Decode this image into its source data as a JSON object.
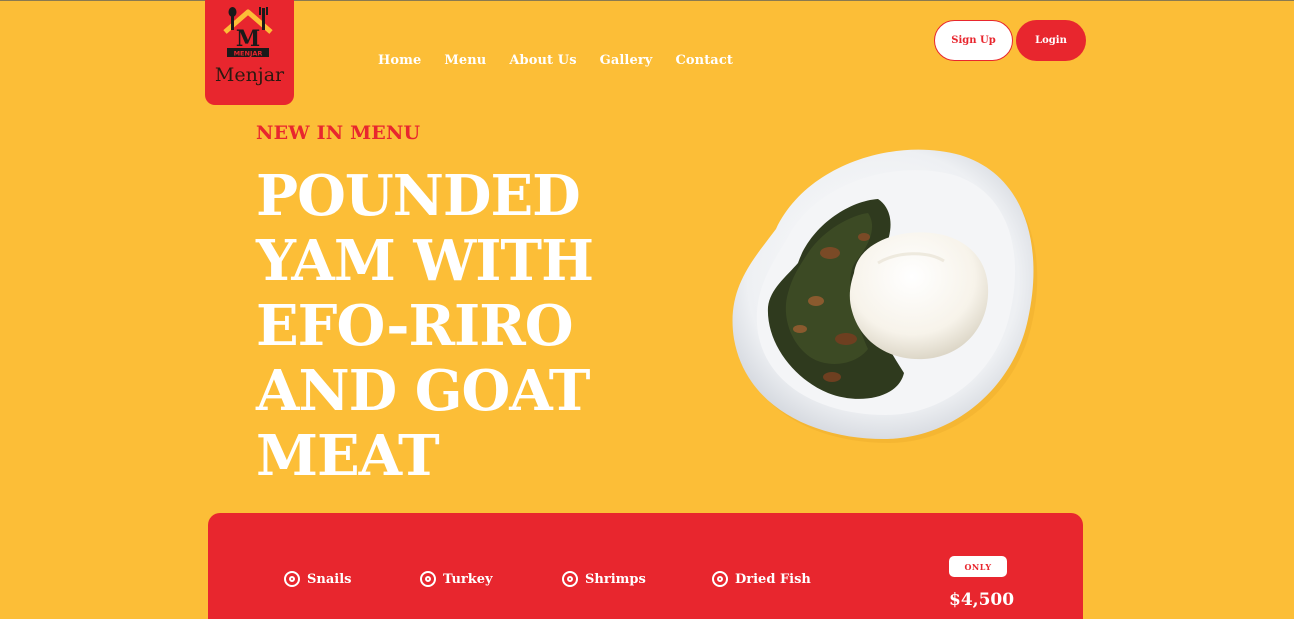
{
  "brand": {
    "logo_text": "Menjar",
    "logo_mark_text": "MENJAR",
    "logo_letter": "M"
  },
  "nav": {
    "items": [
      {
        "label": "Home"
      },
      {
        "label": "Menu"
      },
      {
        "label": "About Us"
      },
      {
        "label": "Gallery"
      },
      {
        "label": "Contact"
      }
    ]
  },
  "auth": {
    "signup_label": "Sign Up",
    "login_label": "Login"
  },
  "hero": {
    "kicker": "NEW IN MENU",
    "headline_lines": [
      "POUNDED",
      "YAM WITH",
      "EFO-RIRO",
      "AND GOAT",
      "MEAT"
    ]
  },
  "offer": {
    "ingredients": [
      {
        "label": "Snails"
      },
      {
        "label": "Turkey"
      },
      {
        "label": "Shrimps"
      },
      {
        "label": "Dried Fish"
      }
    ],
    "badge": "ONLY",
    "price": "$4,500"
  },
  "colors": {
    "background": "#FCBE37",
    "accent": "#E8262E",
    "text_light": "#ffffff"
  },
  "icons": {
    "ingredient": "target-icon",
    "logo": "house-fork-knife-icon"
  }
}
